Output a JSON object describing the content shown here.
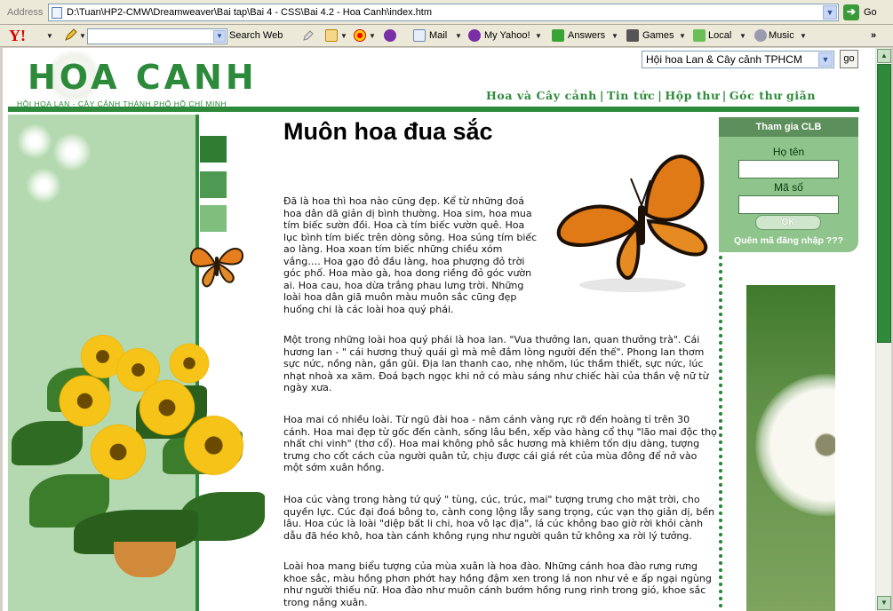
{
  "browser": {
    "address_label": "Address",
    "url": "D:\\Tuan\\HP2-CMW\\Dreamweaver\\Bai tap\\Bai 4 - CSS\\Bai 4.2 - Hoa Canh\\index.htm",
    "go_label": "Go"
  },
  "yahoo_toolbar": {
    "logo": "Y!",
    "search_button": "Search Web",
    "mail": "Mail",
    "my_yahoo": "My Yahoo!",
    "answers": "Answers",
    "games": "Games",
    "local": "Local",
    "music": "Music",
    "more": "»"
  },
  "site": {
    "logo_text": "HOA CANH",
    "logo_subtitle": "HỘI HOA LAN - CÂY CẢNH THÀNH PHỐ HỒ CHÍ MINH",
    "select_value": "Hội hoa Lan & Cây cảnh TPHCM",
    "go_button": "go",
    "nav": [
      "Hoa và Cây cảnh",
      "Tin tức",
      "Hộp thư",
      "Góc thư giãn"
    ]
  },
  "article": {
    "title": "Muôn hoa đua sắc",
    "paragraphs": [
      "Đã là hoa thì hoa nào cũng đẹp. Kể từ những đoá hoa dân dã giản dị bình thường. Hoa sim, hoa mua tím biếc sườn đồi. Hoa cà tím biếc vườn quê. Hoa lục bình tím biếc trên dòng sông. Hoa súng tím biếc ao làng. Hoa xoan tím biếc những chiều xóm vắng…. Hoa gạo đỏ đầu làng, hoa phượng đỏ trời góc phố. Hoa mào gà, hoa dong riềng đỏ góc vườn ai. Hoa cau, hoa dừa trắng phau lưng trời. Những loài hoa dân giã muôn màu muôn sắc cũng đẹp huống chi là các loài hoa quý phái.",
      "Một trong những loài hoa quý phái là hoa lan. \"Vua thưởng lan, quan thưởng trà\". Cái hương lan - \" cái hương thuỷ quái gì mà mê đắm lòng người đến thế\". Phong lan thơm sực nức, nồng nàn, gần gũi. Địa lan thanh cao, nhẹ nhõm, lúc thầm thiết, sực nức, lúc nhạt nhoà xa xăm. Đoá bạch ngọc khi nở có màu sáng như chiếc hài của thần vệ nữ từ ngày xưa.",
      "Hoa mai có nhiều loài. Từ ngũ đài hoa - năm cánh vàng rực rỡ đến hoàng tỉ trên 30 cánh. Hoa mai đẹp từ gốc đến cành, sống lâu bền, xếp vào hàng cổ thụ \"lão mai độc thọ nhất chi vinh\" (thơ cổ). Hoa mai không phô sắc hương mà khiêm tốn dịu dàng, tượng trưng cho cốt cách của người quân tử, chịu được cái giá rét của mùa đông để nở vào một sớm xuân hồng.",
      "Hoa cúc vàng trong hàng tứ quý \" tùng, cúc, trúc, mai\" tượng trưng cho mặt trời, cho quyền lực. Cúc đại đoá bông to, cành cong lộng lẫy sang trọng, cúc vạn thọ giản dị, bền lâu. Hoa cúc là loài \"diệp bất li chi, hoa vô lạc địa\", lá cúc không bao giờ rời khỏi cành dẫu đã héo khô, hoa tàn cánh không rụng như người quân tử không xa rời lý tưởng.",
      "Loài hoa mang biểu tượng của mùa xuân là hoa đào. Những cánh hoa đào rưng rưng khoe sắc, màu hồng phơn phớt hay hồng đậm xen trong lá non như vẻ e ấp ngại ngùng như người thiếu nữ. Hoa đào như muôn cánh bướm hồng rung rinh trong gió, khoe sắc trong nắng xuân."
    ]
  },
  "login": {
    "header": "Tham gia CLB",
    "name_label": "Họ tên",
    "code_label": "Mã số",
    "ok_button": "OK",
    "forgot_link": "Quên mã đăng nhập ???"
  },
  "colors": {
    "brand_green": "#2d8a3a",
    "panel_green": "#8fc58c",
    "left_green": "#b4d9b0"
  }
}
